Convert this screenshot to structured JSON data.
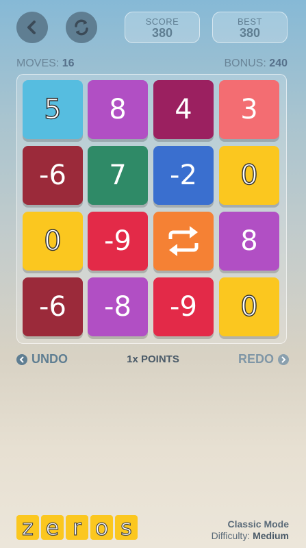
{
  "header": {
    "score_label": "SCORE",
    "score_value": "380",
    "best_label": "BEST",
    "best_value": "380"
  },
  "stats": {
    "moves_label": "MOVES:",
    "moves_value": "16",
    "bonus_label": "BONUS:",
    "bonus_value": "240"
  },
  "board": {
    "rows": [
      [
        {
          "value": "5",
          "color": "#56bde0"
        },
        {
          "value": "8",
          "color": "#b14fc4"
        },
        {
          "value": "4",
          "color": "#9b2060"
        },
        {
          "value": "3",
          "color": "#f36d72"
        }
      ],
      [
        {
          "value": "-6",
          "color": "#9b2a3a"
        },
        {
          "value": "7",
          "color": "#2f8a67"
        },
        {
          "value": "-2",
          "color": "#3a6fcf"
        },
        {
          "value": "0",
          "color": "#fbc71f"
        }
      ],
      [
        {
          "value": "0",
          "color": "#fbc71f"
        },
        {
          "value": "-9",
          "color": "#e32a48"
        },
        {
          "value": "",
          "icon": "swap-icon",
          "color": "#f58134"
        },
        {
          "value": "8",
          "color": "#b14fc4"
        }
      ],
      [
        {
          "value": "-6",
          "color": "#9b2a3a"
        },
        {
          "value": "-8",
          "color": "#b14fc4"
        },
        {
          "value": "-9",
          "color": "#e32a48"
        },
        {
          "value": "0",
          "color": "#fbc71f"
        }
      ]
    ]
  },
  "controls": {
    "undo_label": "UNDO",
    "points_label": "1x POINTS",
    "redo_label": "REDO"
  },
  "footer": {
    "logo_letters": [
      "z",
      "e",
      "r",
      "o",
      "s"
    ],
    "mode": "Classic Mode",
    "difficulty_label": "Difficulty:",
    "difficulty_value": "Medium"
  },
  "icons": {
    "back": "back-arrow-icon",
    "restart": "restart-icon",
    "undo": "undo-arrow-icon",
    "redo": "redo-arrow-icon",
    "swap": "swap-icon"
  }
}
